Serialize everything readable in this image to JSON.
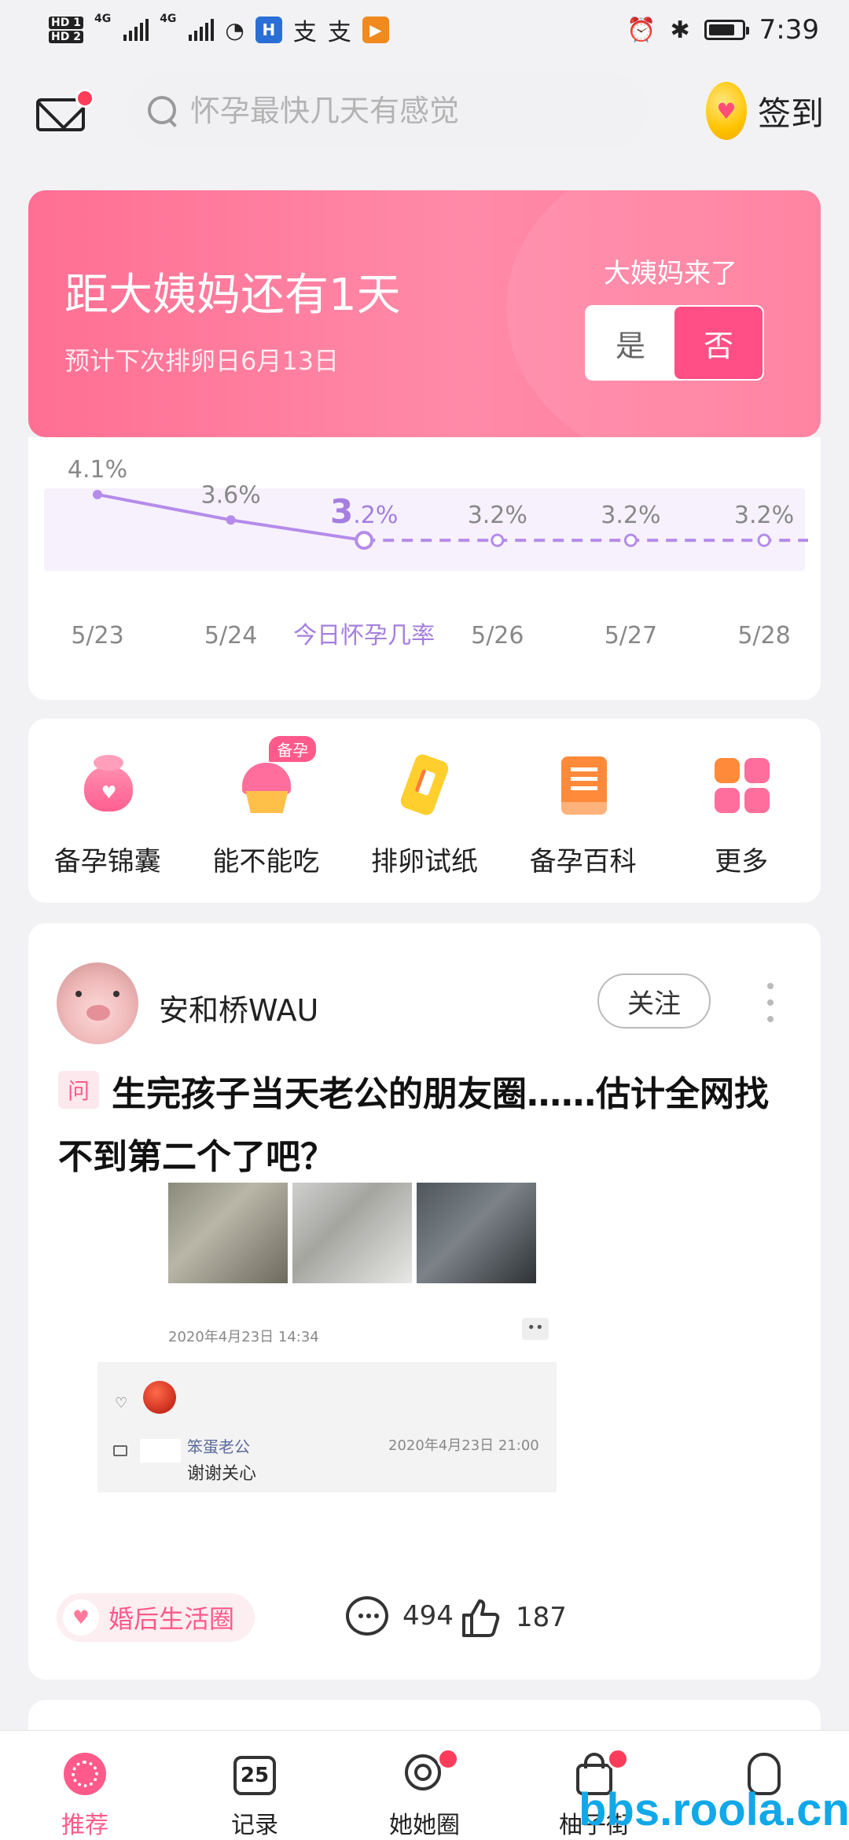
{
  "status_bar": {
    "hd1": "HD 1",
    "hd2": "HD 2",
    "net1": "4G",
    "net2": "4G",
    "app1": "支",
    "app2": "支",
    "time": "7:39"
  },
  "header": {
    "search_placeholder": "怀孕最快几天有感觉",
    "signin_label": "签到"
  },
  "period_card": {
    "title": "距大姨妈还有1天",
    "subtitle": "预计下次排卵日6月13日",
    "question": "大姨妈来了",
    "yes_label": "是",
    "no_label": "否",
    "selected": "否"
  },
  "chart_data": {
    "type": "line",
    "categories": [
      "5/23",
      "5/24",
      "今日怀孕几率",
      "5/26",
      "5/27",
      "5/28"
    ],
    "values": [
      4.1,
      3.6,
      3.2,
      3.2,
      3.2,
      3.2
    ],
    "value_labels": [
      "4.1%",
      "3.6%",
      "3.2%",
      "3.2%",
      "3.2%",
      "3.2%"
    ],
    "today_index": 2,
    "ylim": [
      0,
      5
    ],
    "colors": {
      "line": "#b58bea",
      "fill": "#f6f1fc",
      "today_label": "#a57ee0"
    }
  },
  "tools": [
    {
      "label": "备孕锦囊",
      "icon": "pouch-icon",
      "badge": ""
    },
    {
      "label": "能不能吃",
      "icon": "cupcake-icon",
      "badge": "备孕"
    },
    {
      "label": "排卵试纸",
      "icon": "test-strip-icon",
      "badge": ""
    },
    {
      "label": "备孕百科",
      "icon": "book-icon",
      "badge": ""
    },
    {
      "label": "更多",
      "icon": "grid-icon",
      "badge": ""
    }
  ],
  "post": {
    "username": "安和桥WAU",
    "follow_label": "关注",
    "tag": "问",
    "title": "生完孩子当天老公的朋友圈……估计全网找不到第二个了吧？",
    "embed": {
      "date": "2020年4月23日 14:34",
      "commenter": "笨蛋老公",
      "comment_time": "2020年4月23日 21:00",
      "comment_text": "谢谢关心"
    },
    "topic": "婚后生活圈",
    "comments": "494",
    "likes": "187"
  },
  "bottom_nav": [
    {
      "label": "推荐",
      "active": true
    },
    {
      "label": "记录",
      "active": false,
      "icon_text": "25"
    },
    {
      "label": "她她圈",
      "active": false
    },
    {
      "label": "柚子街",
      "active": false
    },
    {
      "label": "",
      "active": false
    }
  ],
  "watermark": "bbs.roola.cn",
  "colors": {
    "accent": "#ff5a8a",
    "card_pink": "#ff7a9b",
    "badge_red": "#ff3d5a"
  }
}
